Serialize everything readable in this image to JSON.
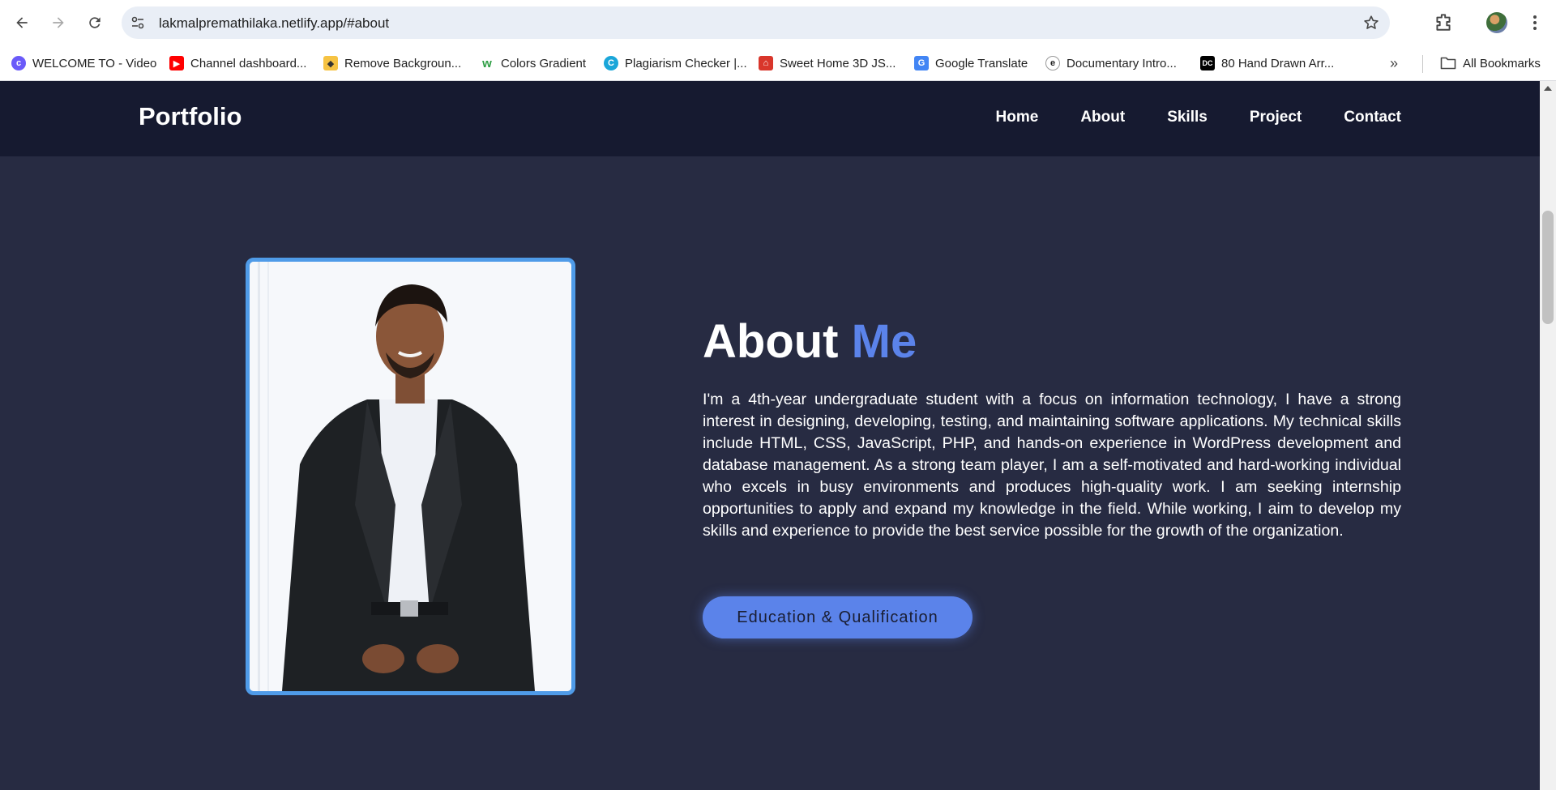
{
  "browser": {
    "url": "lakmalpremathilaka.netlify.app/#about",
    "bookmarks": [
      {
        "label": "WELCOME TO - Video",
        "icon": "canva-icon",
        "color": "#6a5af9"
      },
      {
        "label": "Channel dashboard...",
        "icon": "youtube-icon",
        "color": "#ff0000"
      },
      {
        "label": "Remove Backgroun...",
        "icon": "remove-bg-icon",
        "color": "#f6c343"
      },
      {
        "label": "Colors Gradient",
        "icon": "webgradients-icon",
        "color": "#2e9e44"
      },
      {
        "label": "Plagiarism Checker |...",
        "icon": "plagiarism-icon",
        "color": "#1aa6d9"
      },
      {
        "label": "Sweet Home 3D JS...",
        "icon": "sweethome-icon",
        "color": "#d9362b"
      },
      {
        "label": "Google Translate",
        "icon": "translate-icon",
        "color": "#4285f4"
      },
      {
        "label": "Documentary Intro...",
        "icon": "envato-icon",
        "color": "#1f1f1f"
      },
      {
        "label": "80 Hand Drawn Arr...",
        "icon": "dc-icon",
        "color": "#000000"
      }
    ],
    "all_bookmarks": "All Bookmarks"
  },
  "site": {
    "logo": "Portfolio",
    "nav": [
      "Home",
      "About",
      "Skills",
      "Project",
      "Contact"
    ]
  },
  "about": {
    "title_main": "About",
    "title_accent": "Me",
    "description": "I'm a 4th-year undergraduate student with a focus on information technology, I have a strong interest in designing, developing, testing, and maintaining software applications. My technical skills include HTML, CSS, JavaScript, PHP, and hands-on experience in WordPress development and database management. As a strong team player, I am a self-motivated and hard-working individual who excels in busy environments and produces high-quality work. I am seeking internship opportunities to apply and expand my knowledge in the field. While working, I aim to develop my skills and experience to provide the best service possible for the growth of the organization.",
    "button": "Education & Qualification"
  },
  "colors": {
    "page_bg": "#272b42",
    "header_bg": "#161a30",
    "accent": "#5b83ea",
    "photo_border": "#4f9be8"
  }
}
